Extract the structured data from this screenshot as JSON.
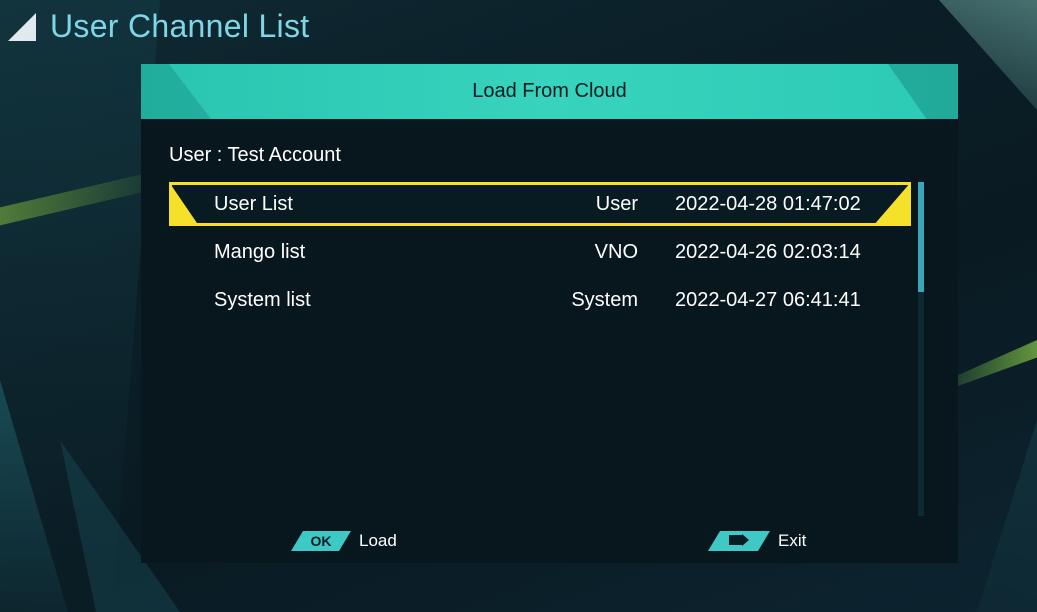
{
  "page": {
    "title": "User Channel List"
  },
  "dialog": {
    "title": "Load From Cloud",
    "user_line": "User : Test Account"
  },
  "list": {
    "rows": [
      {
        "name": "User List",
        "type": "User",
        "date": "2022-04-28 01:47:02",
        "selected": true
      },
      {
        "name": "Mango list",
        "type": "VNO",
        "date": "2022-04-26 02:03:14",
        "selected": false
      },
      {
        "name": "System list",
        "type": "System",
        "date": "2022-04-27 06:41:41",
        "selected": false
      }
    ]
  },
  "footer": {
    "ok_key": "OK",
    "ok_label": "Load",
    "exit_key_icon": "exit-arrow-icon",
    "exit_label": "Exit"
  },
  "colors": {
    "accent_header": "#37d3bd",
    "selection": "#f5e12a",
    "title_text": "#7fd6e6",
    "dialog_bg": "#08171e"
  }
}
